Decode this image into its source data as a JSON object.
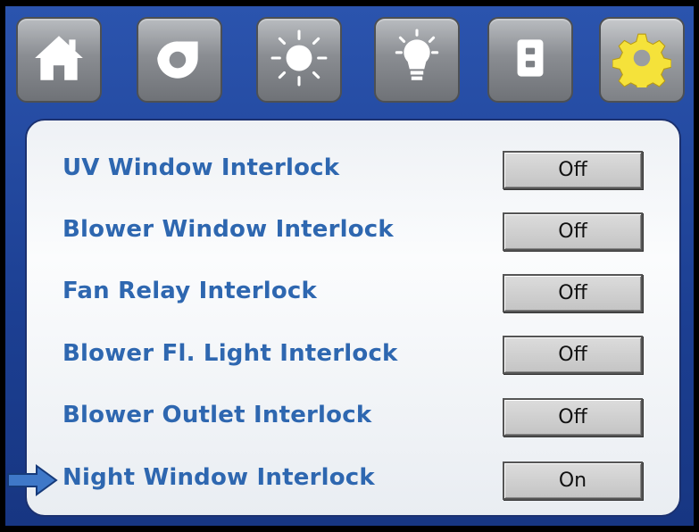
{
  "tabs": [
    {
      "name": "home-icon"
    },
    {
      "name": "blower-icon"
    },
    {
      "name": "uv-light-icon"
    },
    {
      "name": "light-bulb-icon"
    },
    {
      "name": "outlet-icon"
    },
    {
      "name": "gear-icon",
      "active": true
    }
  ],
  "colors": {
    "label": "#2e67b0",
    "background": "#1f4597",
    "accent_gear": "#f5e23a",
    "arrow": "#3f78c8"
  },
  "settings": [
    {
      "label": "UV Window Interlock",
      "value": "Off"
    },
    {
      "label": "Blower Window Interlock",
      "value": "Off"
    },
    {
      "label": "Fan Relay Interlock",
      "value": "Off"
    },
    {
      "label": "Blower Fl. Light Interlock",
      "value": "Off"
    },
    {
      "label": "Blower Outlet Interlock",
      "value": "Off"
    },
    {
      "label": "Night Window Interlock",
      "value": "On",
      "selected": true
    }
  ]
}
